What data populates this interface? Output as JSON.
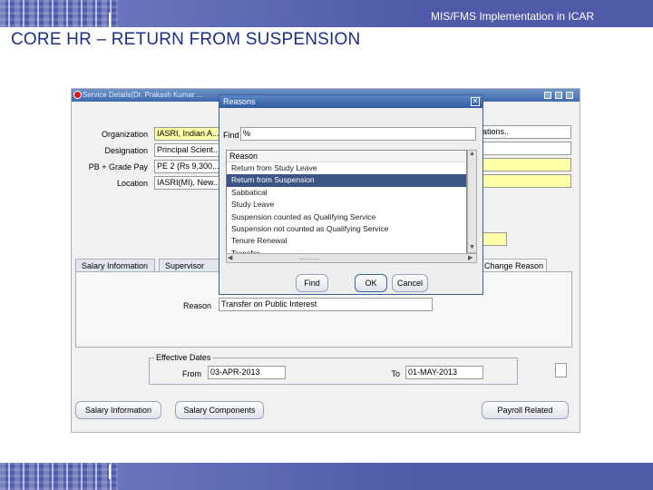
{
  "slide": {
    "header_text": "MIS/FMS Implementation in ICAR",
    "title": "CORE HR – RETURN FROM SUSPENSION"
  },
  "window": {
    "title": "Service Details(Dr. Prakash Kumar ..."
  },
  "fields": {
    "organization": {
      "label": "Organization",
      "value": "IASRI, Indian A..."
    },
    "designation": {
      "label": "Designation",
      "value": "Principal Scient..."
    },
    "pb_grade_pay": {
      "label": "PB + Grade Pay",
      "value": "PE 2 (Rs 9,300..."
    },
    "location": {
      "label": "Location",
      "value": "IASRI(MI), New..."
    },
    "right_field_value": "ations..",
    "reason": {
      "label": "Reason",
      "value": "Transfer on Public Interest"
    }
  },
  "tabs": [
    "Salary Information",
    "Supervisor",
    "Change Reason"
  ],
  "effective_dates": {
    "title": "Effective Dates",
    "from_label": "From",
    "from_value": "03-APR-2013",
    "to_label": "To",
    "to_value": "01-MAY-2013"
  },
  "bottom_buttons": {
    "salary_information": "Salary Information",
    "salary_components": "Salary Components",
    "payroll_related": "Payroll Related"
  },
  "dialog": {
    "title": "Reasons",
    "close_glyph": "✕",
    "find_label": "Find",
    "find_value": "%",
    "column_header": "Reason",
    "items": [
      "Return from Study Leave",
      "Return from Suspension",
      "Sabbatical",
      "Study Leave",
      "Suspension counted as Qualifying Service",
      "Suspension not counted as Qualifying Service",
      "Tenure Renewal",
      "Transfer ..."
    ],
    "selected_index": 1,
    "buttons": {
      "find": "Find",
      "ok": "OK",
      "cancel": "Cancel"
    },
    "hscroll_dots": "........."
  },
  "colors": {
    "band": "#4f5aa8",
    "title_text": "#1b2e8c",
    "selection": "#3d5584",
    "required_field": "#ffffa6"
  },
  "icons": {
    "oracle": "oracle-logo-icon",
    "close": "close-icon",
    "scroll_up": "scroll-up-arrow-icon",
    "scroll_down": "scroll-down-arrow-icon",
    "scroll_left": "scroll-left-arrow-icon",
    "scroll_right": "scroll-right-arrow-icon"
  }
}
